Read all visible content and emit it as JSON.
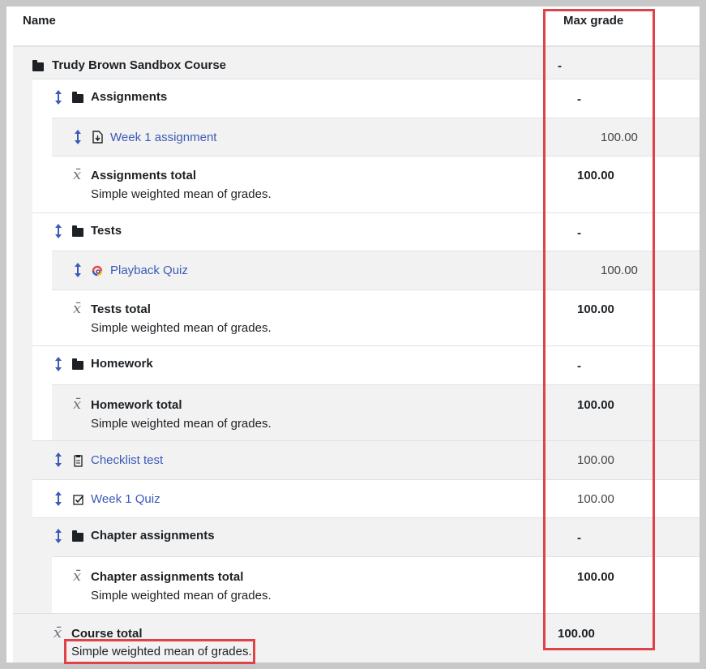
{
  "header": {
    "name": "Name",
    "max_grade": "Max grade"
  },
  "rows": {
    "course": {
      "label": "Trudy Brown Sandbox Course",
      "value": "-"
    },
    "assignments": {
      "label": "Assignments",
      "value": "-"
    },
    "week1_assignment": {
      "label": "Week 1 assignment",
      "value": "100.00"
    },
    "assignments_total": {
      "label": "Assignments total",
      "sub": "Simple weighted mean of grades.",
      "value": "100.00"
    },
    "tests": {
      "label": "Tests",
      "value": "-"
    },
    "playback_quiz": {
      "label": "Playback Quiz",
      "value": "100.00"
    },
    "tests_total": {
      "label": "Tests total",
      "sub": "Simple weighted mean of grades.",
      "value": "100.00"
    },
    "homework": {
      "label": "Homework",
      "value": "-"
    },
    "homework_total": {
      "label": "Homework total",
      "sub": "Simple weighted mean of grades.",
      "value": "100.00"
    },
    "checklist_test": {
      "label": "Checklist test",
      "value": "100.00"
    },
    "week1_quiz": {
      "label": "Week 1 Quiz",
      "value": "100.00"
    },
    "chapter_assignments": {
      "label": "Chapter assignments",
      "value": "-"
    },
    "chapter_total": {
      "label": "Chapter assignments total",
      "sub": "Simple weighted mean of grades.",
      "value": "100.00"
    },
    "course_total": {
      "label": "Course total",
      "sub": "Simple weighted mean of grades.",
      "value": "100.00"
    }
  },
  "icons": {
    "folder": "folder-icon",
    "move": "move-icon",
    "aggregate": "x-bar-icon",
    "assignment": "assignment-icon",
    "quiz_external": "playback-quiz-icon",
    "checklist": "checklist-icon",
    "quiz": "quiz-icon"
  },
  "colors": {
    "link": "#3b5ab7",
    "highlight": "#e0424a",
    "row_grey": "#f2f2f2",
    "move_icon": "#3b5ab7"
  }
}
